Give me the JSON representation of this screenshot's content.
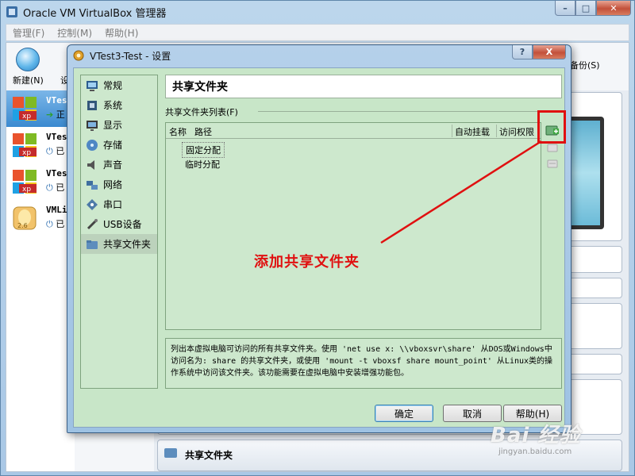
{
  "main_window": {
    "title": "Oracle VM VirtualBox 管理器",
    "menu": [
      "管理(F)",
      "控制(M)",
      "帮助(H)"
    ],
    "toolbar": {
      "new_label": "新建(N)",
      "settings_label": "设",
      "backup_label": "备份(S)"
    },
    "vm_list": [
      {
        "name": "VTes",
        "state": "正",
        "selected": true
      },
      {
        "name": "VTes",
        "state": "已",
        "selected": false
      },
      {
        "name": "VTes",
        "state": "已",
        "selected": false
      },
      {
        "name": "VMLi",
        "state": "已",
        "selected": false
      }
    ],
    "details_bottom": "共享文件夹"
  },
  "dialog": {
    "title": "VTest3-Test - 设置",
    "help_button": "?",
    "close_button": "X",
    "categories": [
      "常规",
      "系统",
      "显示",
      "存储",
      "声音",
      "网络",
      "串口",
      "USB设备",
      "共享文件夹"
    ],
    "selected_category": "共享文件夹",
    "page_title": "共享文件夹",
    "list_label": "共享文件夹列表(F)",
    "columns": {
      "name": "名称",
      "path": "路径",
      "automount": "自动挂载",
      "access": "访问权限"
    },
    "rows": [
      "固定分配",
      "临时分配"
    ],
    "info_text": "列出本虚拟电脑可访问的所有共享文件夹。使用 'net use x: \\\\vboxsvr\\share' 从DOS或Windows中访问名为: share 的共享文件夹，或使用 'mount -t vboxsf share mount_point' 从Linux类的操作系统中访问该文件夹。该功能需要在虚拟电脑中安装增强功能包。",
    "buttons": {
      "ok": "确定",
      "cancel": "取消",
      "help": "帮助(H)"
    }
  },
  "annotation": {
    "text": "添加共享文件夹",
    "color": "#e01010"
  },
  "watermark": {
    "logo": "Bai 经验",
    "url": "jingyan.baidu.com"
  }
}
